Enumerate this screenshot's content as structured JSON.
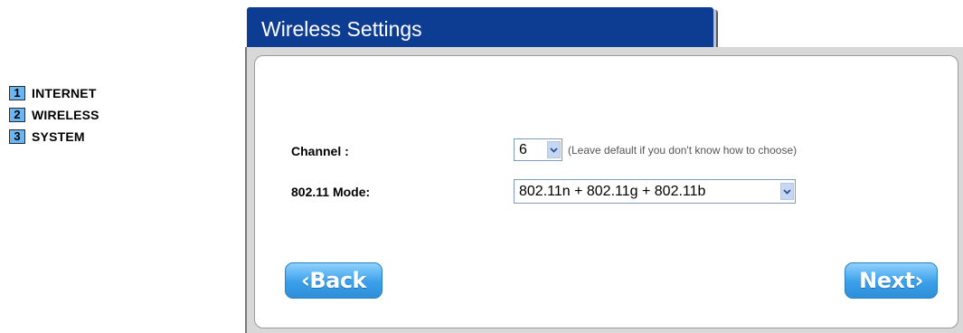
{
  "steps": [
    {
      "number": "1",
      "label": "INTERNET"
    },
    {
      "number": "2",
      "label": "WIRELESS"
    },
    {
      "number": "3",
      "label": "SYSTEM"
    }
  ],
  "header": {
    "title": "Wireless Settings"
  },
  "form": {
    "channel": {
      "label": "Channel :",
      "value": "6",
      "hint": "(Leave default if you don't know how to choose)"
    },
    "mode": {
      "label": "802.11 Mode:",
      "value": "802.11n + 802.11g + 802.11b"
    }
  },
  "buttons": {
    "back": "‹Back",
    "next": "Next›"
  },
  "icons": {
    "dropdown": "chevron-down-icon"
  },
  "colors": {
    "title_bar": "#0d3c93",
    "step_badge": "#6ab6f4",
    "button": "#3a9fe9"
  }
}
